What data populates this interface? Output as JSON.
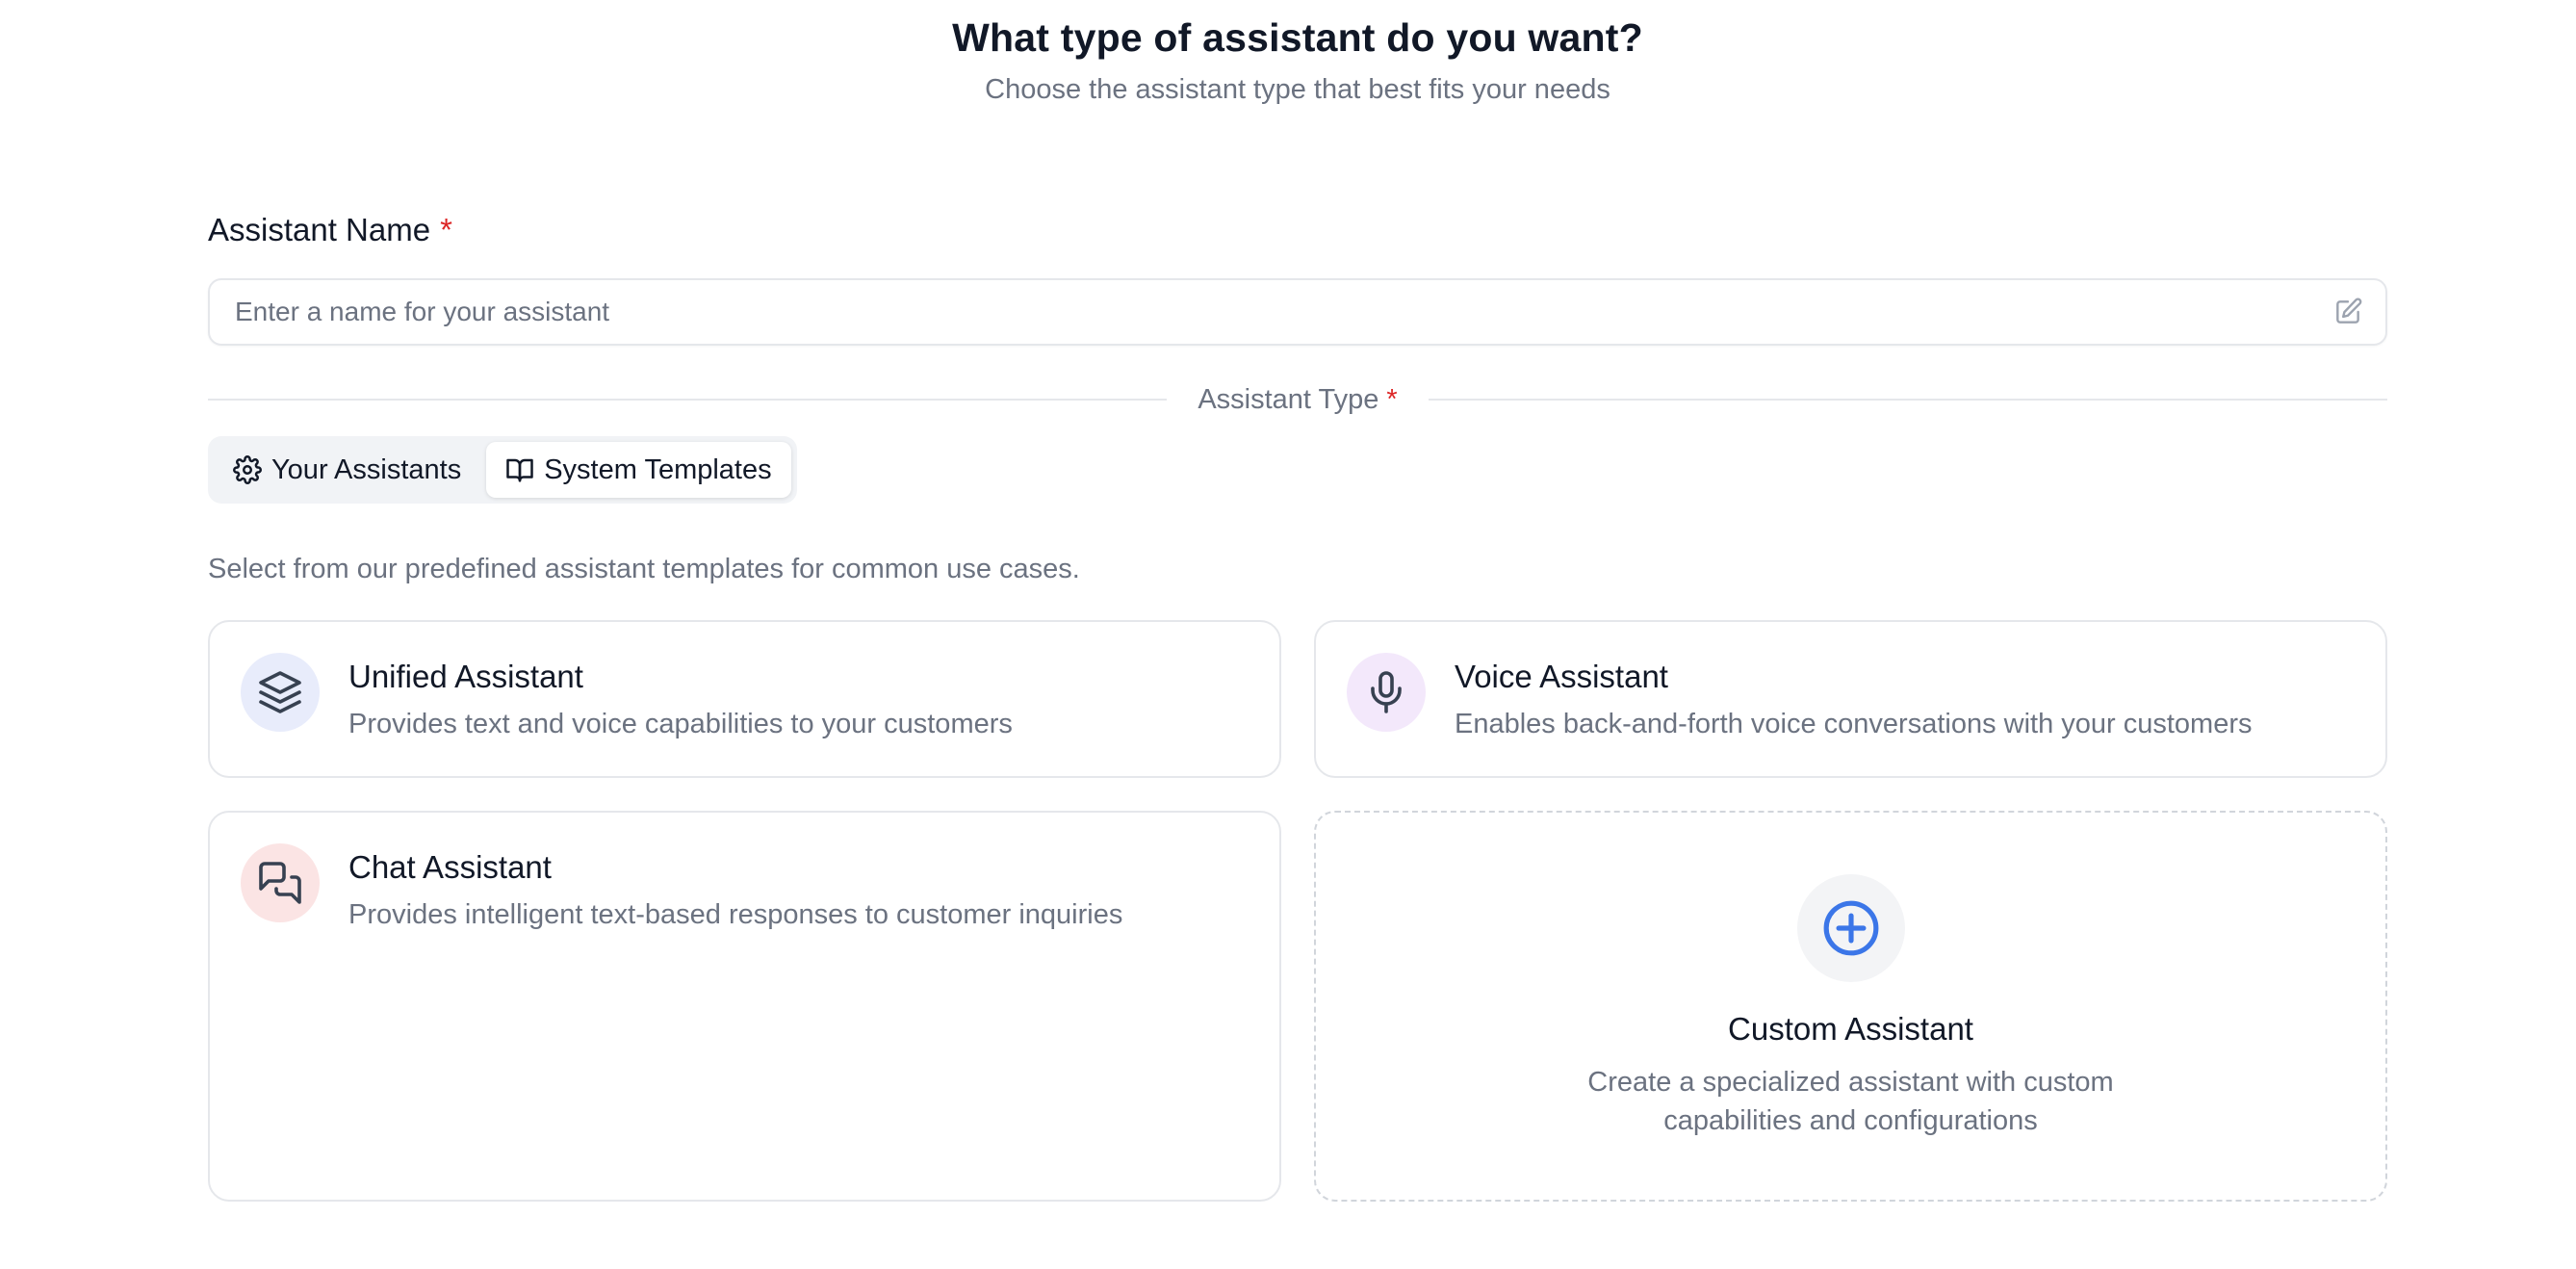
{
  "header": {
    "title": "What type of assistant do you want?",
    "subtitle": "Choose the assistant type that best fits your needs"
  },
  "name_field": {
    "label": "Assistant Name",
    "required_mark": "*",
    "placeholder": "Enter a name for your assistant",
    "value": "",
    "icon": "edit-icon"
  },
  "type_section": {
    "label": "Assistant Type",
    "required_mark": "*"
  },
  "tabs": [
    {
      "label": "Your Assistants",
      "icon": "gear-icon",
      "active": false
    },
    {
      "label": "System Templates",
      "icon": "book-open-icon",
      "active": true
    }
  ],
  "hint": "Select from our predefined assistant templates for common use cases.",
  "templates": [
    {
      "title": "Unified Assistant",
      "description": "Provides text and voice capabilities to your customers",
      "icon": "layers-icon",
      "icon_bg": "#e8ecfb"
    },
    {
      "title": "Voice Assistant",
      "description": "Enables back-and-forth voice conversations with your customers",
      "icon": "microphone-icon",
      "icon_bg": "#f3e8fb"
    },
    {
      "title": "Chat Assistant",
      "description": "Provides intelligent text-based responses to customer inquiries",
      "icon": "chat-bubbles-icon",
      "icon_bg": "#fbe4e4"
    }
  ],
  "custom": {
    "title": "Custom Assistant",
    "description_line1": "Create a specialized assistant with custom",
    "description_line2": "capabilities and configurations",
    "icon": "plus-circle-icon",
    "accent": "#3b76e8"
  },
  "colors": {
    "required": "#dc2626",
    "muted_text": "#6b7280",
    "border": "#e5e7eb"
  }
}
